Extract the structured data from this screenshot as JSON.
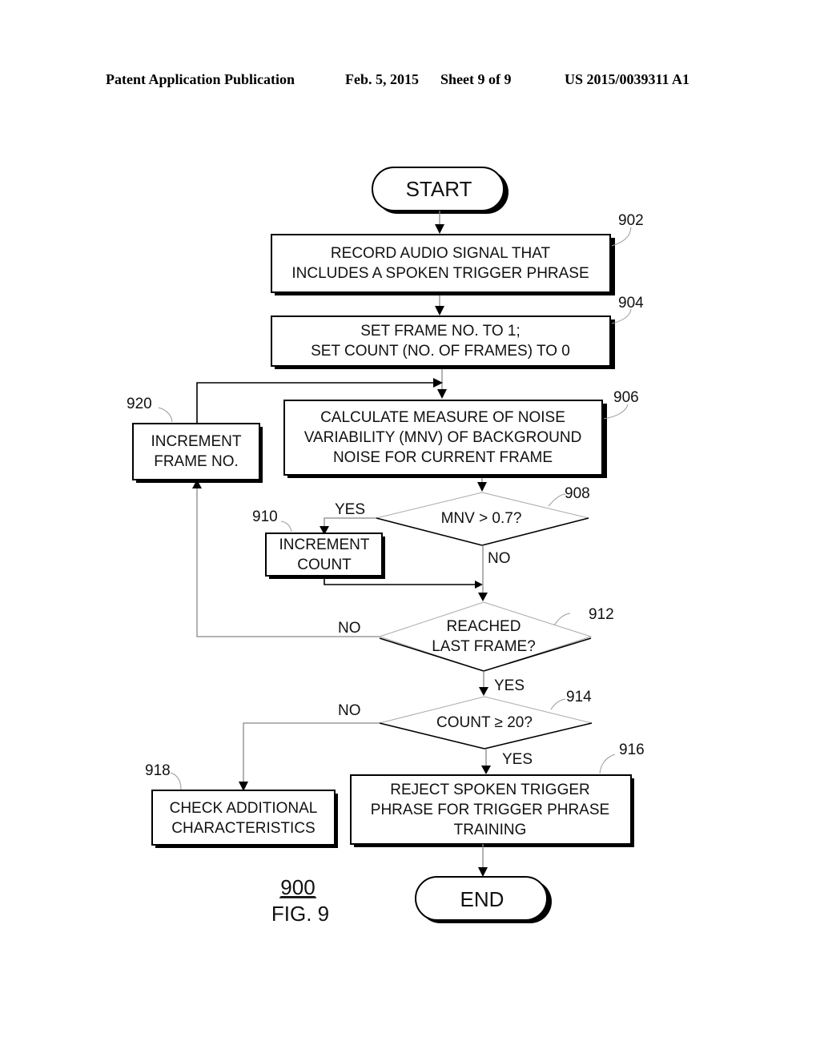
{
  "header": {
    "publication": "Patent Application Publication",
    "date": "Feb. 5, 2015",
    "sheet": "Sheet 9 of 9",
    "number": "US 2015/0039311 A1"
  },
  "figure": {
    "ref": "900",
    "label": "FIG. 9"
  },
  "nodes": {
    "start": {
      "label": "START"
    },
    "n902": {
      "ref": "902",
      "lines": [
        "RECORD AUDIO SIGNAL THAT",
        "INCLUDES A SPOKEN TRIGGER PHRASE"
      ]
    },
    "n904": {
      "ref": "904",
      "lines": [
        "SET FRAME NO. TO 1;",
        "SET COUNT (NO. OF FRAMES) TO 0"
      ]
    },
    "n906": {
      "ref": "906",
      "lines": [
        "CALCULATE MEASURE OF NOISE",
        "VARIABILITY (MNV) OF BACKGROUND",
        "NOISE FOR CURRENT FRAME"
      ]
    },
    "n908": {
      "ref": "908",
      "lines": [
        "MNV > 0.7?"
      ],
      "yes": "YES",
      "no": "NO"
    },
    "n910": {
      "ref": "910",
      "lines": [
        "INCREMENT",
        "COUNT"
      ]
    },
    "n912": {
      "ref": "912",
      "lines": [
        "REACHED",
        "LAST FRAME?"
      ],
      "yes": "YES",
      "no": "NO"
    },
    "n914": {
      "ref": "914",
      "lines": [
        "COUNT ≥ 20?"
      ],
      "yes": "YES",
      "no": "NO"
    },
    "n916": {
      "ref": "916",
      "lines": [
        "REJECT SPOKEN TRIGGER",
        "PHRASE FOR TRIGGER PHRASE",
        "TRAINING"
      ]
    },
    "n918": {
      "ref": "918",
      "lines": [
        "CHECK ADDITIONAL",
        "CHARACTERISTICS"
      ]
    },
    "n920": {
      "ref": "920",
      "lines": [
        "INCREMENT",
        "FRAME NO."
      ]
    },
    "end": {
      "label": "END"
    }
  }
}
